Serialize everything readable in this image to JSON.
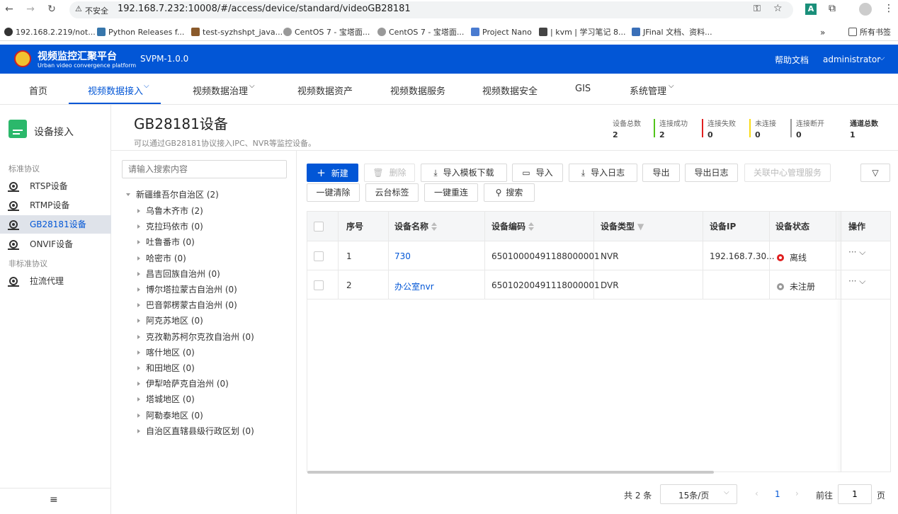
{
  "browser": {
    "security_label": "不安全",
    "url": "192.168.7.232:10008/#/access/device/standard/videoGB28181",
    "bookmarks": [
      "192.168.2.219/not...",
      "Python Releases f...",
      "test-syzhshpt_java...",
      "CentOS 7 - 宝塔面...",
      "CentOS 7 - 宝塔面...",
      "Project Nano",
      "| kvm | 学习笔记 8...",
      "JFinal 文档、资料...",
      "所有书签"
    ]
  },
  "app": {
    "title": "视频监控汇聚平台",
    "subtitle": "Urban video convergence platform",
    "version": "SVPM-1.0.0",
    "help": "帮助文档",
    "user": "administrator"
  },
  "nav": [
    "首页",
    "视频数据接入",
    "视频数据治理",
    "视频数据资产",
    "视频数据服务",
    "视频数据安全",
    "GIS",
    "系统管理"
  ],
  "sidebar": {
    "title": "设备接入",
    "group1": "标准协议",
    "items1": [
      "RTSP设备",
      "RTMP设备",
      "GB28181设备",
      "ONVIF设备"
    ],
    "group2": "非标准协议",
    "items2": [
      "拉流代理"
    ]
  },
  "page": {
    "title": "GB28181设备",
    "desc": "可以通过GB28181协议接入IPC、NVR等监控设备。"
  },
  "stats": [
    {
      "label": "设备总数",
      "value": "2",
      "color": ""
    },
    {
      "label": "连接成功",
      "value": "2",
      "color": "#52c41a"
    },
    {
      "label": "连接失败",
      "value": "0",
      "color": "#e02020"
    },
    {
      "label": "未连接",
      "value": "0",
      "color": "#fadb14"
    },
    {
      "label": "连接断开",
      "value": "0",
      "color": "#999999"
    },
    {
      "label": "通道总数",
      "value": "1",
      "color": ""
    }
  ],
  "search": {
    "placeholder": "请输入搜索内容"
  },
  "tree": {
    "root": "新疆维吾尔自治区 (2)",
    "children": [
      "乌鲁木齐市 (2)",
      "克拉玛依市 (0)",
      "吐鲁番市 (0)",
      "哈密市 (0)",
      "昌吉回族自治州 (0)",
      "博尔塔拉蒙古自治州 (0)",
      "巴音郭楞蒙古自治州 (0)",
      "阿克苏地区 (0)",
      "克孜勒苏柯尔克孜自治州 (0)",
      "喀什地区 (0)",
      "和田地区 (0)",
      "伊犁哈萨克自治州 (0)",
      "塔城地区 (0)",
      "阿勒泰地区 (0)",
      "自治区直辖县级行政区划 (0)"
    ]
  },
  "toolbar": {
    "new": "新建",
    "delete": "删除",
    "template": "导入模板下载",
    "import": "导入",
    "import_log": "导入日志",
    "export": "导出",
    "export_log": "导出日志",
    "center": "关联中心管理服务",
    "clear": "一键清除",
    "ptz": "云台标签",
    "reconnect": "一键重连",
    "search": "搜索"
  },
  "table": {
    "headers": [
      "序号",
      "设备名称",
      "设备编码",
      "设备类型",
      "设备IP",
      "设备状态",
      "操作"
    ],
    "rows": [
      {
        "no": "1",
        "name": "730",
        "code": "65010000491188000001",
        "type": "NVR",
        "ip": "192.168.7.30...",
        "status": "离线",
        "status_color": "#e02020"
      },
      {
        "no": "2",
        "name": "办公室nvr",
        "code": "65010200491118000001",
        "type": "DVR",
        "ip": "",
        "status": "未注册",
        "status_color": "#999999"
      }
    ]
  },
  "pagination": {
    "total": "共 2 条",
    "size": "15条/页",
    "current": "1",
    "goto": "前往",
    "goto_val": "1",
    "unit": "页"
  }
}
